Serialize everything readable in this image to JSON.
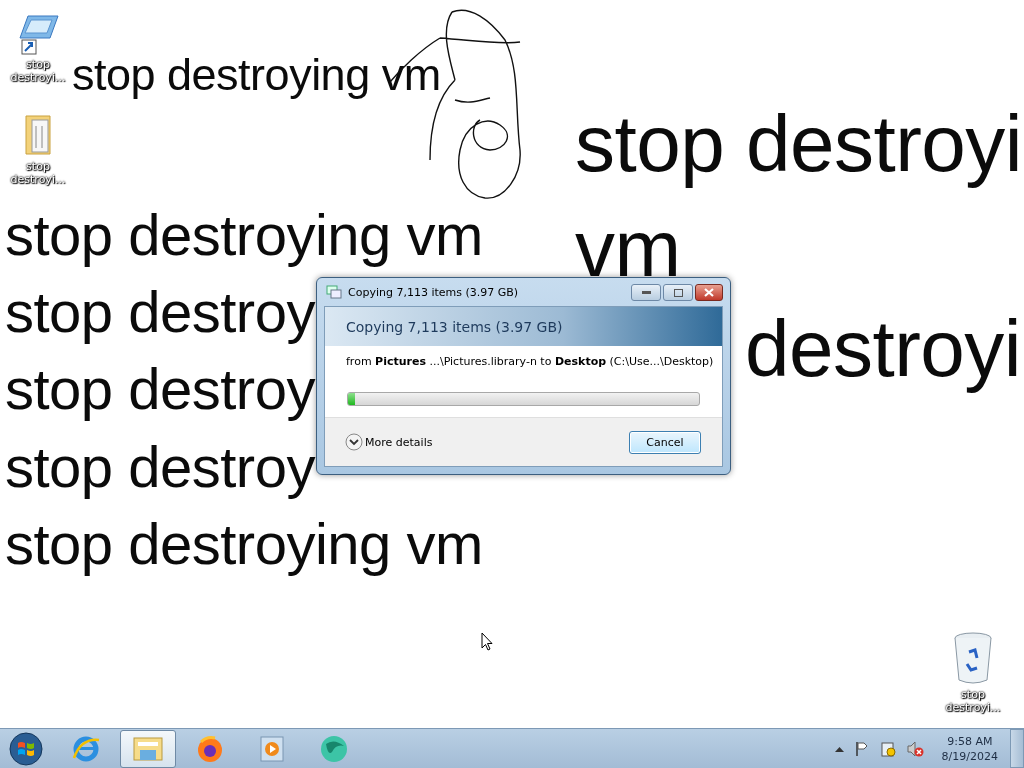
{
  "wallpaper": {
    "texts": [
      "stop destroying vm",
      "stop destroying vm",
      "stop destroy",
      "stop destroy",
      "stop destroy",
      "stop destroying vm",
      "stop destroyi",
      "vm",
      "destroyi"
    ]
  },
  "desktop_icons": [
    {
      "kind": "shortcut",
      "label": "stop destroyi..."
    },
    {
      "kind": "folder",
      "label": "stop destroyi..."
    },
    {
      "kind": "recycle",
      "label": "stop destroyi..."
    }
  ],
  "dialog": {
    "title": "Copying 7,113 items (3.97 GB)",
    "heading": "Copying 7,113 items (3.97 GB)",
    "detail": "from **Pictures** ...\\Pictures.library-n to **Desktop** (C:\\Use...\\Desktop)",
    "progress": {
      "level": 0.02
    },
    "more_details": "More details",
    "cancel": "Cancel"
  },
  "taskbar": {
    "apps": [
      {
        "kind": "ie",
        "selected": false
      },
      {
        "kind": "explorer",
        "selected": true
      },
      {
        "kind": "firefox",
        "selected": false
      },
      {
        "kind": "media",
        "selected": false
      },
      {
        "kind": "globe",
        "selected": false
      }
    ],
    "time": "9:58 AM",
    "date": "8/19/2024"
  }
}
